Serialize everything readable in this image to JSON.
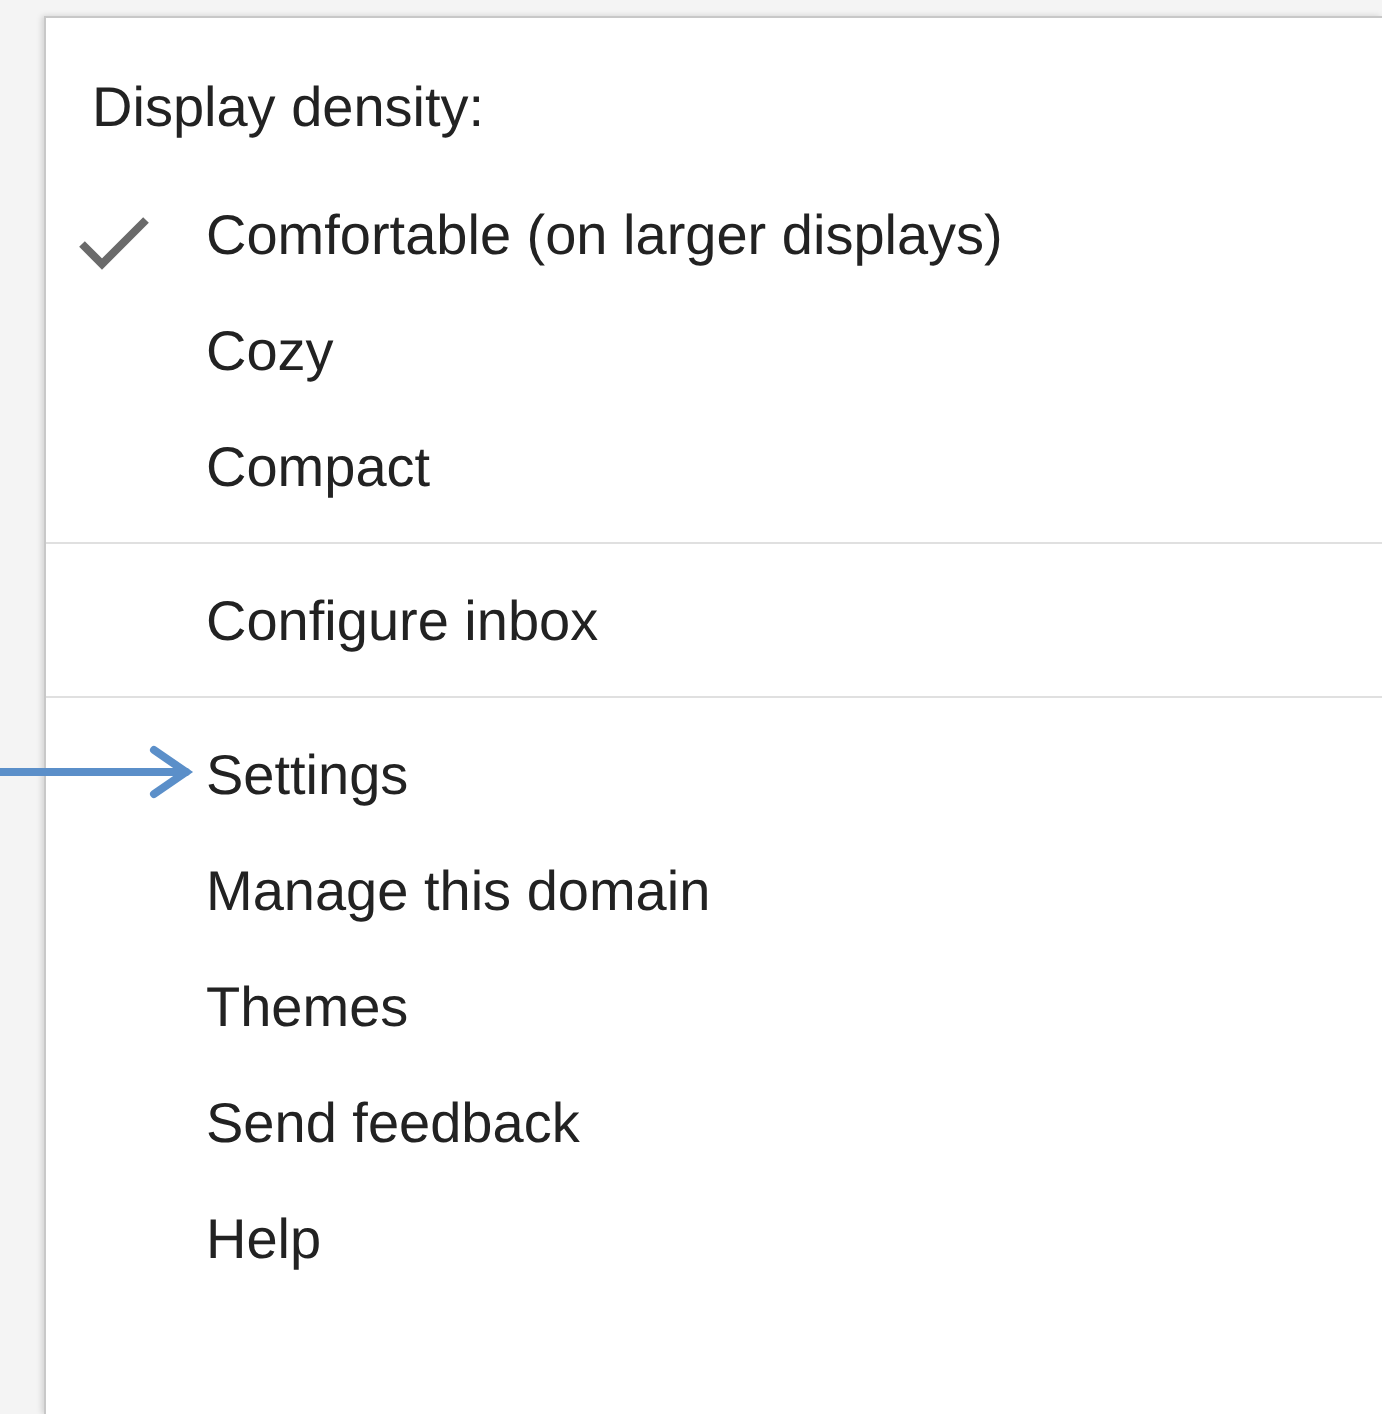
{
  "menu": {
    "sections": [
      {
        "kind": "options",
        "heading": "Display density:",
        "items": [
          {
            "label": "Comfortable (on larger displays)",
            "checked": true
          },
          {
            "label": "Cozy",
            "checked": false
          },
          {
            "label": "Compact",
            "checked": false
          }
        ]
      },
      {
        "kind": "actions",
        "items": [
          {
            "label": "Configure inbox"
          }
        ]
      },
      {
        "kind": "actions",
        "items": [
          {
            "label": "Settings",
            "pointed": true
          },
          {
            "label": "Manage this domain"
          },
          {
            "label": "Themes"
          },
          {
            "label": "Send feedback"
          },
          {
            "label": "Help"
          }
        ]
      }
    ]
  }
}
